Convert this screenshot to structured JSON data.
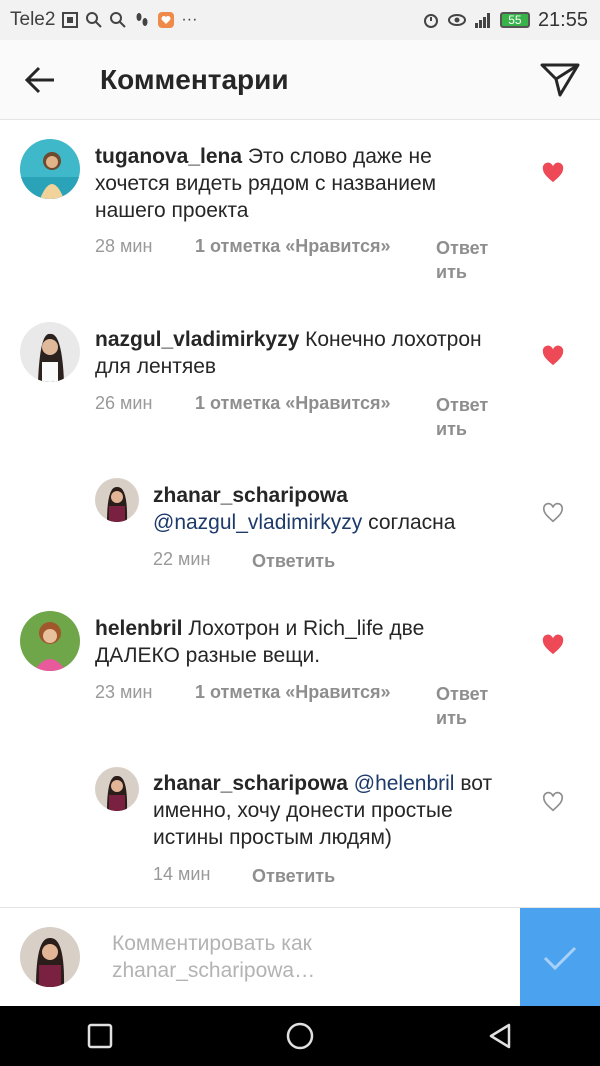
{
  "status_bar": {
    "carrier": "Tele2",
    "battery": "55",
    "time": "21:55"
  },
  "header": {
    "title": "Комментарии"
  },
  "comments": [
    {
      "username": "tuganova_lena",
      "text": "Это слово даже не хочется видеть рядом с названием нашего проекта",
      "time": "28 мин",
      "likes": "1 отметка «Нравится»",
      "reply_label": "Ответить",
      "liked": true
    },
    {
      "username": "nazgul_vladimirkyzy",
      "text": "Конечно лохотрон для лентяев",
      "time": "26 мин",
      "likes": "1 отметка «Нравится»",
      "reply_label": "Ответить",
      "liked": true
    },
    {
      "username": "zhanar_scharipowa",
      "mention": "@nazgul_vladimirkyzy",
      "text": "согласна",
      "time": "22 мин",
      "reply_label": "Ответить",
      "liked": false
    },
    {
      "username": "helenbril",
      "text": "Лохотрон и Rich_life две ДАЛЕКО  разные вещи.",
      "time": "23 мин",
      "likes": "1 отметка «Нравится»",
      "reply_label": "Ответить",
      "liked": true
    },
    {
      "username": "zhanar_scharipowa",
      "mention": "@helenbril",
      "text": "вот именно, хочу донести простые истины простым людям)",
      "time": "14 мин",
      "reply_label": "Ответить",
      "liked": false
    }
  ],
  "input": {
    "placeholder": "Комментировать как zhanar_scharipowa…"
  },
  "colors": {
    "heart_red": "#ed4956",
    "send_blue": "#4ba3f0",
    "mention_blue": "#1d3a6b"
  }
}
